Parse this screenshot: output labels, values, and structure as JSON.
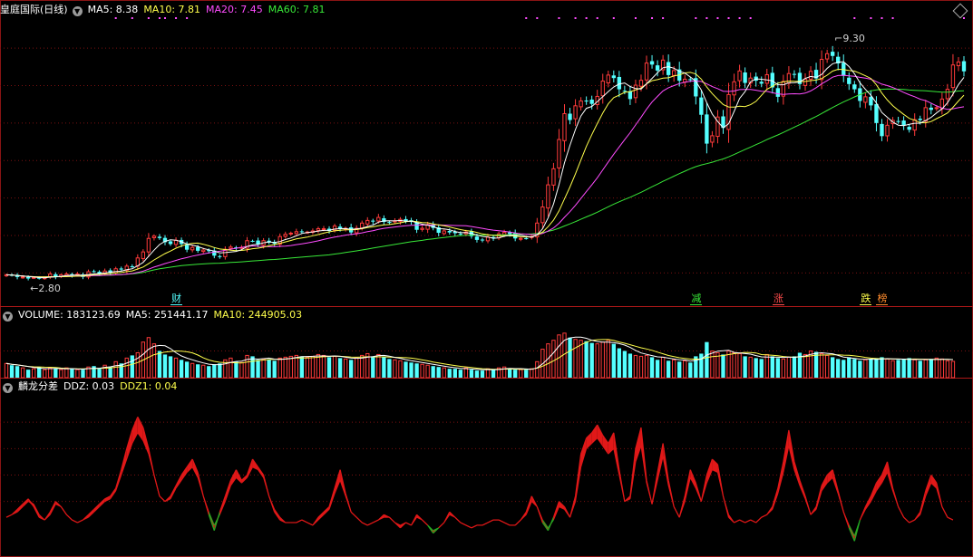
{
  "colors": {
    "up": "#ff3b3b",
    "down": "#54ffff",
    "ma5": "#ffffff",
    "ma10": "#ffff4c",
    "ma20": "#ff4cff",
    "ma60": "#38e838",
    "grid": "#7a1010",
    "ddz_red": "#e01818",
    "ddz_green": "#22aa22"
  },
  "header": {
    "title": "皇庭国际(日线)",
    "ma5": "MA5: 8.38",
    "ma10": "MA10: 7.81",
    "ma20": "MA20: 7.45",
    "ma60": "MA60: 7.81"
  },
  "volume_header": {
    "title": "VOLUME: 183123.69",
    "ma5": "MA5: 251441.17",
    "ma10": "MA10: 244905.03"
  },
  "ddz_header": {
    "title": "麟龙分差",
    "ddz": "DDZ: 0.03",
    "ddz1": "DDZ1: 0.04"
  },
  "annotations": {
    "high": "9.30",
    "low": "2.80"
  },
  "events": [
    {
      "label": "财",
      "color": "#54ffff",
      "bar": 31
    },
    {
      "label": "减",
      "color": "#38e838",
      "bar": 126
    },
    {
      "label": "涨",
      "color": "#ff4c4c",
      "bar": 141
    },
    {
      "label": "跌",
      "color": "#ffff4c",
      "bar": 157
    },
    {
      "label": "榜",
      "color": "#ff8c2e",
      "bar": 160
    }
  ],
  "chart_data": [
    {
      "type": "candlestick",
      "y_range": [
        2.5,
        9.8
      ],
      "series": [
        {
          "name": "price",
          "closes": [
            2.95,
            2.94,
            2.89,
            2.89,
            2.85,
            2.88,
            2.86,
            2.87,
            2.97,
            2.89,
            2.95,
            2.97,
            2.93,
            2.97,
            2.89,
            3.03,
            3.04,
            2.98,
            3.05,
            3.0,
            3.11,
            3.09,
            3.18,
            3.17,
            3.4,
            3.56,
            3.92,
            3.98,
            3.93,
            3.82,
            3.77,
            3.87,
            3.77,
            3.62,
            3.68,
            3.59,
            3.61,
            3.58,
            3.46,
            3.43,
            3.63,
            3.69,
            3.66,
            3.68,
            3.86,
            3.85,
            3.76,
            3.86,
            3.81,
            3.78,
            3.97,
            4.03,
            4.06,
            4.1,
            4.1,
            4.09,
            4.12,
            4.18,
            4.18,
            4.12,
            4.25,
            4.17,
            4.19,
            4.08,
            4.19,
            4.33,
            4.4,
            4.37,
            4.48,
            4.36,
            4.34,
            4.39,
            4.43,
            4.38,
            4.36,
            4.15,
            4.19,
            4.29,
            4.2,
            4.07,
            4.12,
            4.08,
            4.06,
            4.04,
            4.09,
            3.98,
            3.88,
            3.88,
            3.96,
            3.92,
            4.04,
            4.08,
            4.04,
            3.92,
            3.92,
            3.92,
            3.97,
            4.33,
            4.76,
            5.35,
            5.78,
            6.56,
            7.25,
            7.08,
            7.46,
            7.59,
            7.58,
            7.51,
            7.71,
            8.12,
            8.28,
            8.2,
            7.9,
            7.85,
            7.64,
            8.01,
            8.14,
            8.6,
            8.56,
            8.4,
            8.68,
            8.28,
            8.4,
            8.13,
            8.17,
            8.16,
            7.71,
            7.22,
            6.45,
            6.66,
            7.16,
            6.87,
            7.76,
            8.1,
            8.39,
            8.07,
            8.2,
            8.13,
            8.05,
            8.29,
            7.95,
            7.7,
            8.11,
            8.32,
            8.31,
            8.04,
            8.17,
            8.38,
            8.19,
            8.7,
            8.85,
            8.79,
            8.59,
            8.26,
            8.04,
            7.9,
            7.59,
            7.7,
            7.47,
            7.0,
            6.65,
            6.94,
            7.07,
            7.05,
            6.94,
            6.82,
            7.09,
            7.08,
            7.41,
            7.35,
            7.41,
            7.64,
            7.9,
            8.55,
            8.63,
            8.38
          ]
        }
      ]
    },
    {
      "type": "bar",
      "name": "VOLUME",
      "y_range": [
        0,
        600000
      ],
      "values": [
        160000,
        140000,
        130000,
        110000,
        90000,
        100000,
        120000,
        90000,
        110000,
        100000,
        90000,
        110000,
        100000,
        90000,
        90000,
        120000,
        130000,
        100000,
        140000,
        120000,
        180000,
        160000,
        220000,
        250000,
        280000,
        400000,
        450000,
        380000,
        300000,
        260000,
        240000,
        220000,
        200000,
        180000,
        160000,
        150000,
        140000,
        130000,
        150000,
        160000,
        200000,
        220000,
        180000,
        170000,
        250000,
        240000,
        200000,
        210000,
        200000,
        190000,
        220000,
        230000,
        240000,
        250000,
        240000,
        230000,
        240000,
        260000,
        250000,
        230000,
        240000,
        220000,
        210000,
        200000,
        220000,
        250000,
        270000,
        240000,
        260000,
        230000,
        210000,
        200000,
        190000,
        180000,
        170000,
        160000,
        150000,
        140000,
        130000,
        120000,
        110000,
        100000,
        100000,
        90000,
        110000,
        90000,
        80000,
        80000,
        100000,
        90000,
        110000,
        120000,
        100000,
        90000,
        90000,
        90000,
        100000,
        180000,
        320000,
        380000,
        420000,
        480000,
        500000,
        450000,
        430000,
        420000,
        410000,
        390000,
        380000,
        400000,
        420000,
        380000,
        330000,
        300000,
        270000,
        250000,
        240000,
        250000,
        230000,
        200000,
        230000,
        190000,
        200000,
        180000,
        190000,
        170000,
        240000,
        270000,
        400000,
        300000,
        280000,
        260000,
        300000,
        280000,
        270000,
        240000,
        230000,
        220000,
        210000,
        260000,
        240000,
        220000,
        210000,
        230000,
        240000,
        280000,
        260000,
        300000,
        290000,
        270000,
        250000,
        230000,
        210000,
        200000,
        230000,
        210000,
        190000,
        200000,
        210000,
        220000,
        230000,
        210000,
        190000,
        200000,
        210000,
        220000,
        200000,
        190000,
        200000,
        210000,
        220000,
        210000,
        190000,
        183124
      ]
    },
    {
      "type": "area",
      "name": "麟龙分差",
      "y_range": [
        -0.1,
        0.5
      ],
      "series": [
        {
          "name": "DDZ",
          "values": [
            0.04,
            0.05,
            0.07,
            0.09,
            0.11,
            0.08,
            0.04,
            0.03,
            0.06,
            0.1,
            0.08,
            0.05,
            0.03,
            0.02,
            0.03,
            0.05,
            0.07,
            0.09,
            0.11,
            0.12,
            0.15,
            0.22,
            0.3,
            0.37,
            0.42,
            0.38,
            0.3,
            0.2,
            0.12,
            0.1,
            0.12,
            0.16,
            0.2,
            0.23,
            0.26,
            0.21,
            0.12,
            0.05,
            -0.01,
            0.06,
            0.12,
            0.18,
            0.22,
            0.18,
            0.2,
            0.26,
            0.23,
            0.2,
            0.12,
            0.06,
            0.03,
            0.02,
            0.02,
            0.02,
            0.03,
            0.02,
            0.01,
            0.04,
            0.06,
            0.08,
            0.15,
            0.22,
            0.13,
            0.06,
            0.04,
            0.02,
            0.01,
            0.02,
            0.03,
            0.05,
            0.04,
            0.02,
            0.0,
            0.02,
            0.01,
            0.05,
            0.03,
            0.01,
            -0.02,
            0.0,
            0.02,
            0.06,
            0.04,
            0.02,
            0.01,
            0.0,
            0.01,
            0.01,
            0.02,
            0.03,
            0.03,
            0.02,
            0.01,
            0.01,
            0.03,
            0.06,
            0.12,
            0.08,
            0.02,
            -0.01,
            0.04,
            0.1,
            0.08,
            0.04,
            0.12,
            0.28,
            0.34,
            0.36,
            0.39,
            0.35,
            0.32,
            0.36,
            0.22,
            0.1,
            0.12,
            0.3,
            0.38,
            0.18,
            0.09,
            0.21,
            0.32,
            0.18,
            0.08,
            0.04,
            0.12,
            0.22,
            0.17,
            0.1,
            0.2,
            0.26,
            0.24,
            0.12,
            0.04,
            0.02,
            0.03,
            0.02,
            0.03,
            0.02,
            0.04,
            0.05,
            0.08,
            0.15,
            0.25,
            0.37,
            0.25,
            0.18,
            0.12,
            0.05,
            0.08,
            0.16,
            0.2,
            0.22,
            0.14,
            0.06,
            0.0,
            -0.05,
            0.03,
            0.08,
            0.12,
            0.17,
            0.2,
            0.25,
            0.15,
            0.08,
            0.04,
            0.02,
            0.03,
            0.06,
            0.14,
            0.2,
            0.17,
            0.08,
            0.04,
            0.03
          ]
        },
        {
          "name": "DDZ1",
          "values": [
            0.04,
            0.05,
            0.06,
            0.08,
            0.1,
            0.09,
            0.05,
            0.03,
            0.05,
            0.09,
            0.08,
            0.05,
            0.03,
            0.02,
            0.03,
            0.04,
            0.06,
            0.08,
            0.1,
            0.11,
            0.14,
            0.2,
            0.26,
            0.32,
            0.36,
            0.33,
            0.28,
            0.2,
            0.12,
            0.1,
            0.11,
            0.15,
            0.18,
            0.21,
            0.23,
            0.19,
            0.12,
            0.06,
            0.01,
            0.05,
            0.1,
            0.16,
            0.19,
            0.17,
            0.19,
            0.23,
            0.22,
            0.19,
            0.12,
            0.07,
            0.04,
            0.02,
            0.02,
            0.02,
            0.03,
            0.02,
            0.01,
            0.03,
            0.05,
            0.07,
            0.13,
            0.18,
            0.12,
            0.06,
            0.04,
            0.02,
            0.01,
            0.02,
            0.03,
            0.04,
            0.04,
            0.02,
            0.01,
            0.02,
            0.01,
            0.04,
            0.03,
            0.01,
            -0.01,
            0.0,
            0.02,
            0.05,
            0.04,
            0.02,
            0.01,
            0.0,
            0.01,
            0.01,
            0.02,
            0.03,
            0.03,
            0.02,
            0.01,
            0.01,
            0.03,
            0.05,
            0.1,
            0.08,
            0.03,
            0.0,
            0.03,
            0.08,
            0.07,
            0.04,
            0.1,
            0.23,
            0.3,
            0.32,
            0.34,
            0.31,
            0.28,
            0.3,
            0.2,
            0.1,
            0.11,
            0.25,
            0.31,
            0.17,
            0.09,
            0.18,
            0.27,
            0.16,
            0.08,
            0.04,
            0.1,
            0.19,
            0.15,
            0.1,
            0.17,
            0.22,
            0.21,
            0.12,
            0.05,
            0.02,
            0.03,
            0.02,
            0.03,
            0.02,
            0.04,
            0.05,
            0.07,
            0.13,
            0.21,
            0.31,
            0.22,
            0.16,
            0.11,
            0.05,
            0.07,
            0.14,
            0.17,
            0.19,
            0.13,
            0.06,
            0.01,
            -0.03,
            0.03,
            0.07,
            0.1,
            0.14,
            0.17,
            0.21,
            0.14,
            0.08,
            0.04,
            0.02,
            0.03,
            0.05,
            0.12,
            0.17,
            0.15,
            0.08,
            0.04,
            0.03
          ]
        }
      ]
    }
  ]
}
